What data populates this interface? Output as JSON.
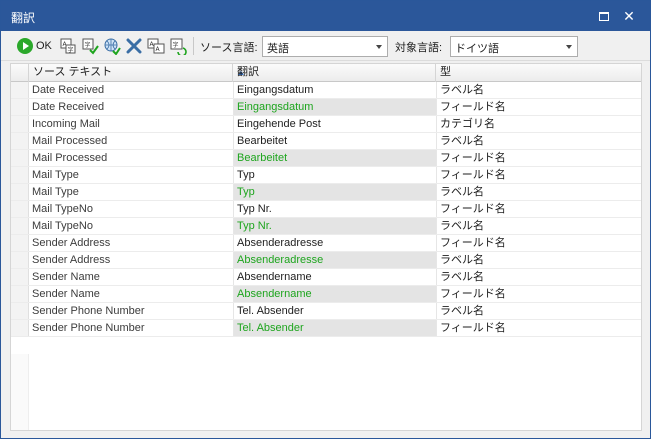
{
  "window": {
    "title": "翻訳"
  },
  "titlebar": {
    "maximize_glyph": "□",
    "close_glyph": "✕"
  },
  "toolbar": {
    "ok_label": "OK",
    "source_lang_label": "ソース言語:",
    "source_lang_value": "英語",
    "target_lang_label": "対象言語:",
    "target_lang_value": "ドイツ語",
    "icons": [
      "import-glossary-icon",
      "apply-check-icon",
      "web-translate-icon",
      "delete-icon",
      "copy-source-icon",
      "refresh-translation-icon"
    ]
  },
  "grid": {
    "columns": [
      "ソース テキスト",
      "翻訳",
      "型"
    ],
    "sort_column": "ソース テキスト",
    "sort_direction": "ascending",
    "rows": [
      {
        "source": "Date Received",
        "translation": "Eingangsdatum",
        "type": "ラベル名",
        "highlight": false
      },
      {
        "source": "Date Received",
        "translation": "Eingangsdatum",
        "type": "フィールド名",
        "highlight": true
      },
      {
        "source": "Incoming Mail",
        "translation": "Eingehende Post",
        "type": "カテゴリ名",
        "highlight": false
      },
      {
        "source": "Mail Processed",
        "translation": "Bearbeitet",
        "type": "ラベル名",
        "highlight": false
      },
      {
        "source": "Mail Processed",
        "translation": "Bearbeitet",
        "type": "フィールド名",
        "highlight": true
      },
      {
        "source": "Mail Type",
        "translation": "Typ",
        "type": "フィールド名",
        "highlight": false
      },
      {
        "source": "Mail Type",
        "translation": "Typ",
        "type": "ラベル名",
        "highlight": true
      },
      {
        "source": "Mail TypeNo",
        "translation": "Typ Nr.",
        "type": "フィールド名",
        "highlight": false
      },
      {
        "source": "Mail TypeNo",
        "translation": "Typ Nr.",
        "type": "ラベル名",
        "highlight": true
      },
      {
        "source": "Sender Address",
        "translation": "Absenderadresse",
        "type": "フィールド名",
        "highlight": false
      },
      {
        "source": "Sender Address",
        "translation": "Absenderadresse",
        "type": "ラベル名",
        "highlight": true
      },
      {
        "source": "Sender Name",
        "translation": "Absendername",
        "type": "ラベル名",
        "highlight": false
      },
      {
        "source": "Sender Name",
        "translation": "Absendername",
        "type": "フィールド名",
        "highlight": true
      },
      {
        "source": "Sender Phone Number",
        "translation": "Tel. Absender",
        "type": "ラベル名",
        "highlight": false
      },
      {
        "source": "Sender Phone Number",
        "translation": "Tel. Absender",
        "type": "フィールド名",
        "highlight": true
      }
    ]
  },
  "colors": {
    "titlebar": "#2b579a",
    "highlight_text": "#1ea51e",
    "highlight_bg": "#e4e4e4"
  }
}
